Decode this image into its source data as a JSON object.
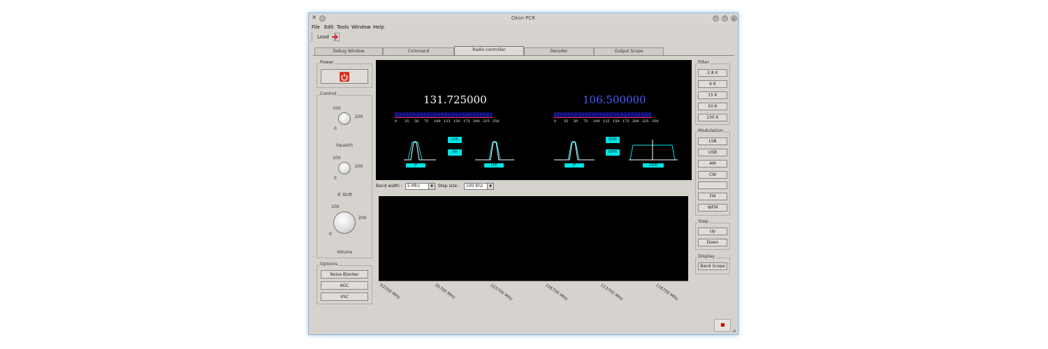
{
  "window": {
    "title": "Okon PCR"
  },
  "menu": [
    "File",
    "Edit",
    "Tools",
    "Window",
    "Help"
  ],
  "toolbar": {
    "load_label": "Load"
  },
  "tabs": [
    "Debug Window",
    "Command",
    "Radio controller",
    "Decoder",
    "Output Scope"
  ],
  "power": {
    "label": "Power"
  },
  "control": {
    "label": "Control",
    "knobs": [
      {
        "name": "Squelch",
        "min": "0",
        "mid": "100",
        "max": "200"
      },
      {
        "name": "IF Shift",
        "min": "0",
        "mid": "100",
        "max": "200"
      },
      {
        "name": "Volume",
        "min": "0",
        "mid": "100",
        "max": "200"
      }
    ]
  },
  "options": {
    "label": "Options",
    "buttons": [
      "Noise Blanker",
      "AGC",
      "VSC"
    ]
  },
  "filter": {
    "label": "Filter",
    "buttons": [
      "2.8 K",
      "6 K",
      "15 K",
      "50 K",
      "230 K"
    ]
  },
  "modulation": {
    "label": "Modulation",
    "buttons": [
      "LSB",
      "USB",
      "AM",
      "CW",
      "",
      "FM",
      "WFM"
    ]
  },
  "step": {
    "label": "Step",
    "buttons": [
      "Up",
      "Down"
    ]
  },
  "display": {
    "label": "Display",
    "buttons": [
      "Band Scope"
    ]
  },
  "receivers": [
    {
      "freq": "131.725000",
      "freq_color": "#ffffff",
      "filter": "15K",
      "mode": "AM",
      "if": "IF",
      "bw": "15K"
    },
    {
      "freq": "106.500000",
      "freq_color": "#4a5cff",
      "filter": "300k",
      "mode": "WFM",
      "if": "IF",
      "bw": "230K"
    }
  ],
  "scale_ticks": [
    "0",
    "25",
    "50",
    "75",
    "100",
    "125",
    "150",
    "175",
    "200",
    "225",
    "250"
  ],
  "bandwidth": {
    "label": "Band width :",
    "value": "5 Mhz"
  },
  "stepsize": {
    "label": "Step size :",
    "value": "100 Khz"
  },
  "band_axis": [
    "93700 MHz",
    "95700 MHz",
    "103700 MHz",
    "106700 MHz",
    "113700 MHz",
    "116700 MHz"
  ]
}
